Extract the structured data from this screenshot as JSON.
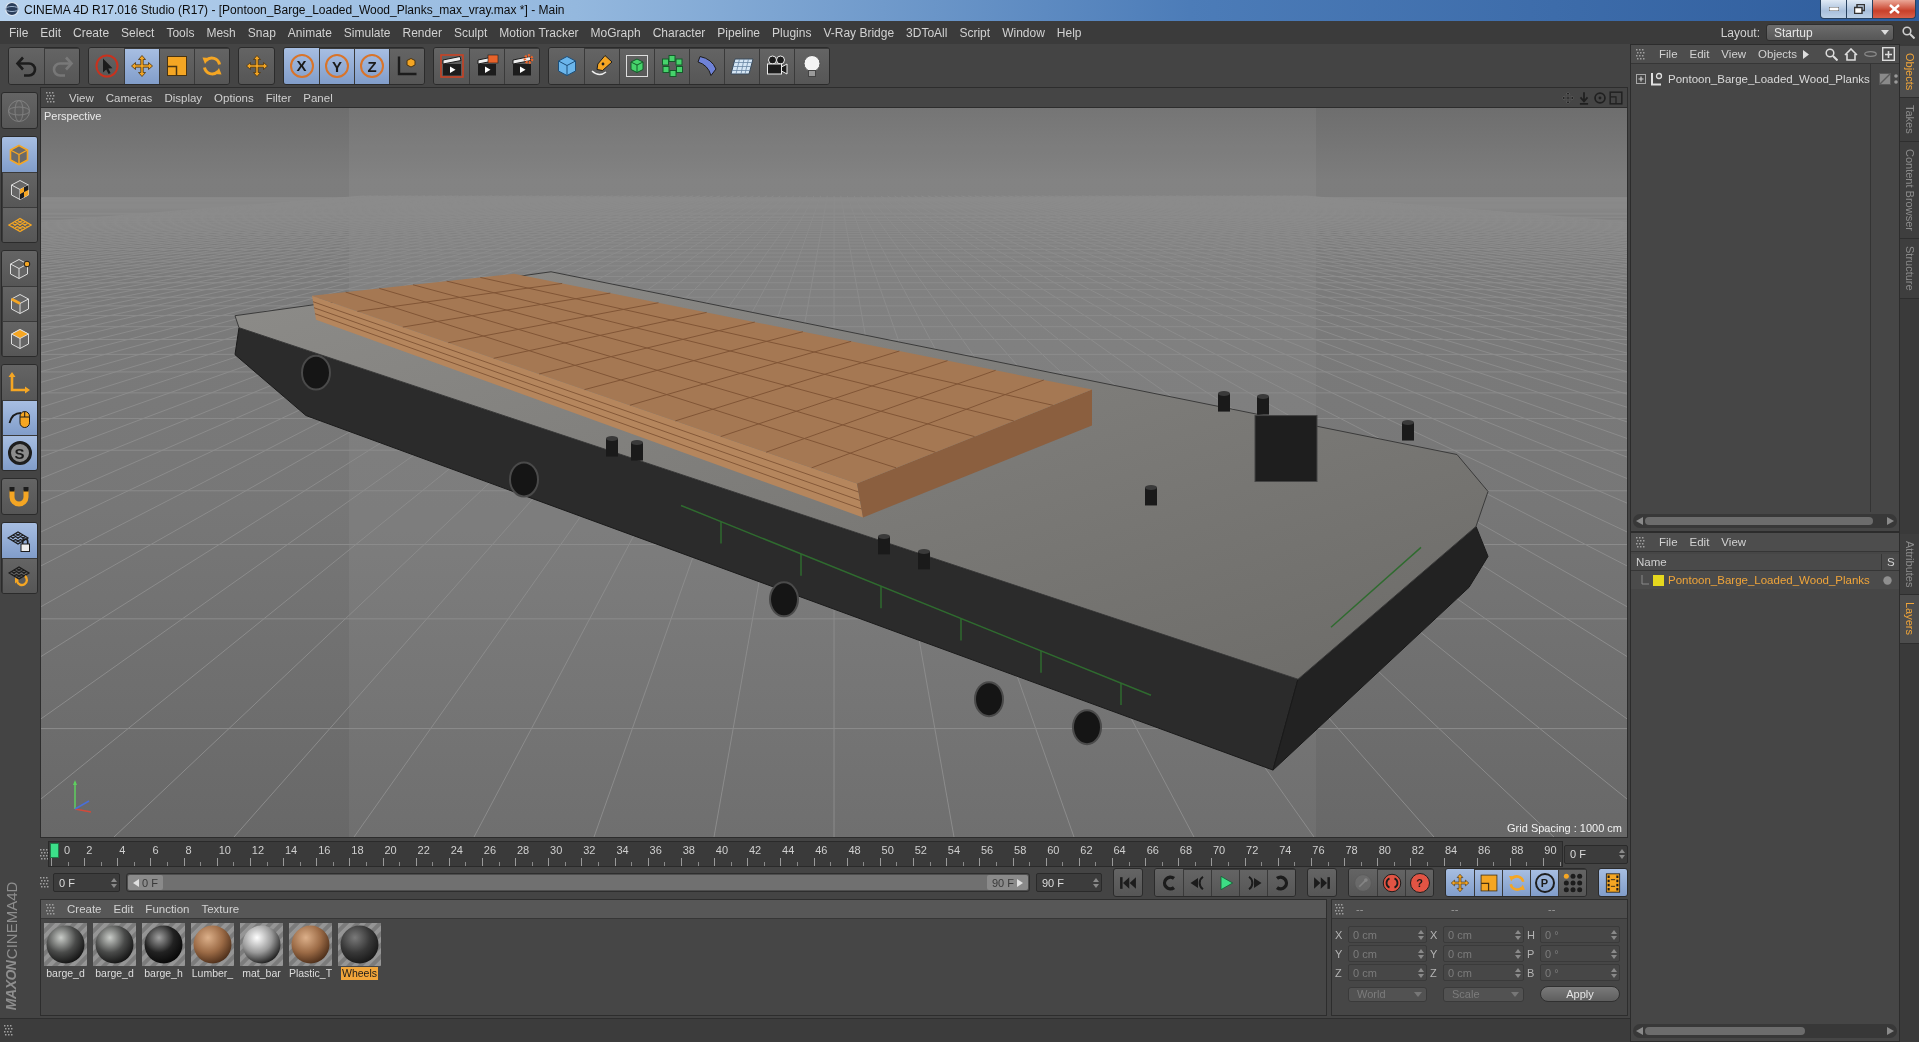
{
  "window": {
    "title": "CINEMA 4D R17.016 Studio (R17) - [Pontoon_Barge_Loaded_Wood_Planks_max_vray.max *] - Main"
  },
  "menu_bar": [
    "File",
    "Edit",
    "Create",
    "Select",
    "Tools",
    "Mesh",
    "Snap",
    "Animate",
    "Simulate",
    "Render",
    "Sculpt",
    "Motion Tracker",
    "MoGraph",
    "Character",
    "Pipeline",
    "Plugins",
    "V-Ray Bridge",
    "3DToAll",
    "Script",
    "Window",
    "Help"
  ],
  "layout": {
    "label": "Layout:",
    "value": "Startup"
  },
  "toolbar": [
    [
      {
        "kind": "undo",
        "selected": false,
        "disabled": false
      },
      {
        "kind": "redo",
        "selected": false,
        "disabled": true
      }
    ],
    [
      {
        "kind": "select",
        "selected": false,
        "disabled": false
      },
      {
        "kind": "move",
        "selected": true,
        "disabled": false
      },
      {
        "kind": "scale",
        "selected": false,
        "disabled": false
      },
      {
        "kind": "rotate",
        "selected": false,
        "disabled": false
      }
    ],
    [
      {
        "kind": "transform",
        "selected": false,
        "disabled": false
      }
    ],
    [
      {
        "kind": "axis-lock",
        "label": "X",
        "selected": true,
        "disabled": false
      },
      {
        "kind": "axis-lock",
        "label": "Y",
        "selected": true,
        "disabled": false
      },
      {
        "kind": "axis-lock",
        "label": "Z",
        "selected": true,
        "disabled": false
      },
      {
        "kind": "coordinates",
        "selected": false,
        "disabled": false
      }
    ],
    [
      {
        "kind": "render-view",
        "selected": false,
        "disabled": false
      },
      {
        "kind": "render-viewer",
        "selected": false,
        "disabled": false
      },
      {
        "kind": "render-settings",
        "selected": false,
        "disabled": false
      }
    ],
    [
      {
        "kind": "cube",
        "selected": false,
        "disabled": false
      },
      {
        "kind": "pen",
        "selected": false,
        "disabled": false
      },
      {
        "kind": "subdivision",
        "selected": false,
        "disabled": false
      },
      {
        "kind": "cloner",
        "selected": false,
        "disabled": false
      },
      {
        "kind": "deformer",
        "selected": false,
        "disabled": false
      },
      {
        "kind": "floor",
        "selected": false,
        "disabled": false
      },
      {
        "kind": "camera",
        "selected": false,
        "disabled": false
      },
      {
        "kind": "light",
        "selected": false,
        "disabled": false
      }
    ]
  ],
  "mode_toolbar": [
    [
      {
        "kind": "make-editable",
        "selected": false,
        "disabled": true
      }
    ],
    [
      {
        "kind": "model",
        "selected": true,
        "disabled": false
      },
      {
        "kind": "texture",
        "selected": false,
        "disabled": false
      },
      {
        "kind": "workplane",
        "selected": false,
        "disabled": false
      }
    ],
    [
      {
        "kind": "points",
        "selected": false,
        "disabled": false
      },
      {
        "kind": "edges",
        "selected": false,
        "disabled": false
      },
      {
        "kind": "polygons",
        "selected": false,
        "disabled": false
      }
    ],
    [
      {
        "kind": "axis",
        "selected": false,
        "disabled": false
      },
      {
        "kind": "tweak",
        "selected": true,
        "disabled": false
      },
      {
        "kind": "snap",
        "label": "S",
        "selected": true,
        "disabled": false
      }
    ],
    [
      {
        "kind": "magnet",
        "selected": false,
        "disabled": false
      }
    ],
    [
      {
        "kind": "lock-workplane",
        "selected": true,
        "disabled": false
      },
      {
        "kind": "align-workplane",
        "selected": false,
        "disabled": false
      }
    ]
  ],
  "logo": {
    "brand": "MAXON",
    "product": "CINEMA4D"
  },
  "viewport": {
    "menu": [
      "View",
      "Cameras",
      "Display",
      "Options",
      "Filter",
      "Panel"
    ],
    "camera": "Perspective",
    "grid_spacing": "Grid Spacing : 1000 cm"
  },
  "timeline": {
    "ticks": [
      "0",
      "2",
      "4",
      "6",
      "8",
      "10",
      "12",
      "14",
      "16",
      "18",
      "20",
      "22",
      "24",
      "26",
      "28",
      "30",
      "32",
      "34",
      "36",
      "38",
      "40",
      "42",
      "44",
      "46",
      "48",
      "50",
      "52",
      "54",
      "56",
      "58",
      "60",
      "62",
      "64",
      "66",
      "68",
      "70",
      "72",
      "74",
      "76",
      "78",
      "80",
      "82",
      "84",
      "86",
      "88",
      "90"
    ],
    "playhead": {
      "level": 0
    },
    "frame_field": "0 F"
  },
  "transport": {
    "start_field": "0 F",
    "range": {
      "start": {
        "label": "0 F",
        "level": 0
      },
      "end": {
        "label": "90 F",
        "level": 1
      }
    },
    "end_field": "90 F",
    "groups": [
      [
        {
          "kind": "go-start",
          "selected": false,
          "disabled": false
        }
      ],
      [
        {
          "kind": "prev-key",
          "selected": false,
          "disabled": false
        },
        {
          "kind": "prev-frame",
          "selected": false,
          "disabled": false
        },
        {
          "kind": "play",
          "selected": false,
          "disabled": false
        },
        {
          "kind": "next-frame",
          "selected": false,
          "disabled": false
        },
        {
          "kind": "next-key",
          "selected": false,
          "disabled": false
        }
      ],
      [
        {
          "kind": "go-end",
          "selected": false,
          "disabled": false
        }
      ],
      [
        {
          "kind": "record-key",
          "selected": false,
          "disabled": true
        },
        {
          "kind": "record",
          "selected": false,
          "disabled": false
        },
        {
          "kind": "autokey",
          "label": "?",
          "selected": false,
          "disabled": false
        }
      ],
      [
        {
          "kind": "key-position",
          "selected": true,
          "disabled": false
        },
        {
          "kind": "key-scale",
          "selected": true,
          "disabled": false
        },
        {
          "kind": "key-rotation",
          "selected": true,
          "disabled": false
        },
        {
          "kind": "key-parameter",
          "label": "P",
          "selected": true,
          "disabled": false
        },
        {
          "kind": "key-points",
          "selected": false,
          "disabled": false
        }
      ],
      [
        {
          "kind": "timeline",
          "selected": true,
          "disabled": false
        }
      ]
    ]
  },
  "material_manager": {
    "menu": [
      "Create",
      "Edit",
      "Function",
      "Texture"
    ],
    "materials": [
      {
        "name": "barge_d",
        "kind": "metal",
        "selected": false
      },
      {
        "name": "barge_d",
        "kind": "metal",
        "selected": false
      },
      {
        "name": "barge_h",
        "kind": "glossy",
        "selected": false
      },
      {
        "name": "Lumber_",
        "kind": "wood",
        "selected": false
      },
      {
        "name": "mat_bar",
        "kind": "chrome",
        "selected": false
      },
      {
        "name": "Plastic_T",
        "kind": "wood",
        "selected": false
      },
      {
        "name": "Wheels",
        "kind": "rubber",
        "selected": true
      }
    ]
  },
  "coordinates": {
    "headers": [
      "--",
      "--",
      "--"
    ],
    "rows": [
      {
        "axis": "X",
        "position": "0 cm",
        "size_axis": "X",
        "size": "0 cm",
        "rotation_axis": "H",
        "rotation": "0 °"
      },
      {
        "axis": "Y",
        "position": "0 cm",
        "size_axis": "Y",
        "size": "0 cm",
        "rotation_axis": "P",
        "rotation": "0 °"
      },
      {
        "axis": "Z",
        "position": "0 cm",
        "size_axis": "Z",
        "size": "0 cm",
        "rotation_axis": "B",
        "rotation": "0 °"
      }
    ],
    "disabled": true,
    "mode": "World",
    "size_mode": "Scale",
    "apply": "Apply"
  },
  "objects_panel": {
    "menu": [
      "File",
      "Edit",
      "View",
      "Objects"
    ],
    "objects": [
      {
        "name": "Pontoon_Barge_Loaded_Wood_Planks",
        "expanded": false
      }
    ]
  },
  "layers_panel": {
    "menu": [
      "File",
      "Edit",
      "View"
    ],
    "columns": [
      "Name",
      "S"
    ],
    "layers": [
      {
        "name": "Pontoon_Barge_Loaded_Wood_Planks",
        "color": "#e6d81e",
        "selected": true
      }
    ]
  },
  "side_tabs": {
    "top": [
      {
        "label": "Objects",
        "selected": true
      },
      {
        "label": "Takes",
        "selected": false
      },
      {
        "label": "Content Browser",
        "selected": false
      },
      {
        "label": "Structure",
        "selected": false
      }
    ],
    "bottom": [
      {
        "label": "Attributes",
        "selected": false
      },
      {
        "label": "Layers",
        "selected": true
      }
    ]
  }
}
